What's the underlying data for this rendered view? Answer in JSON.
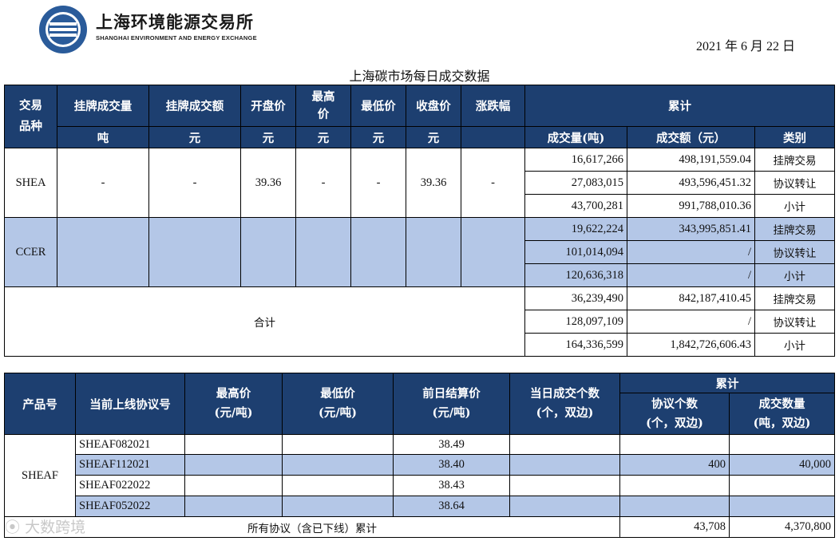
{
  "header": {
    "brand_cn": "上海环境能源交易所",
    "brand_en": "SHANGHAI ENVIRONMENT AND ENERGY EXCHANGE",
    "date": "2021 年 6 月 22 日",
    "title": "上海碳市场每日成交数据"
  },
  "t1": {
    "h": {
      "product": "交易\n品种",
      "listed_vol": "挂牌成交量",
      "listed_amt": "挂牌成交额",
      "open": "开盘价",
      "high": "最高\n价",
      "low": "最低价",
      "close": "收盘价",
      "change": "涨跌幅",
      "cumulative": "累计",
      "u_ton": "吨",
      "u_yuan1": "元",
      "u_yuan2": "元",
      "u_yuan3": "元",
      "u_yuan4": "元",
      "u_yuan5": "元",
      "vol": "成交量(吨)",
      "amt": "成交额（元）",
      "cat": "类别"
    },
    "shea": {
      "name": "SHEA",
      "listed_vol": "-",
      "listed_amt": "-",
      "open": "39.36",
      "high": "-",
      "low": "-",
      "close": "39.36",
      "change": "-",
      "rows": [
        {
          "vol": "16,617,266",
          "amt": "498,191,559.04",
          "cat": "挂牌交易"
        },
        {
          "vol": "27,083,015",
          "amt": "493,596,451.32",
          "cat": "协议转让"
        },
        {
          "vol": "43,700,281",
          "amt": "991,788,010.36",
          "cat": "小计"
        }
      ]
    },
    "ccer": {
      "name": "CCER",
      "rows": [
        {
          "vol": "19,622,224",
          "amt": "343,995,851.41",
          "cat": "挂牌交易"
        },
        {
          "vol": "101,014,094",
          "amt": "/",
          "cat": "协议转让"
        },
        {
          "vol": "120,636,318",
          "amt": "/",
          "cat": "小计"
        }
      ]
    },
    "total": {
      "name": "合计",
      "rows": [
        {
          "vol": "36,239,490",
          "amt": "842,187,410.45",
          "cat": "挂牌交易"
        },
        {
          "vol": "128,097,109",
          "amt": "/",
          "cat": "协议转让"
        },
        {
          "vol": "164,336,599",
          "amt": "1,842,726,606.43",
          "cat": "小计"
        }
      ]
    }
  },
  "t2": {
    "h": {
      "product": "产品号",
      "contract": "当前上线协议号",
      "high": "最高价",
      "high_u": "(元/吨)",
      "low": "最低价",
      "low_u": "(元/吨)",
      "settle": "前日结算价",
      "settle_u": "(元/吨)",
      "deals": "当日成交个数",
      "deals_u": "(个，双边)",
      "cumulative": "累计",
      "agreements": "协议个数",
      "agreements_u": "(个，双边)",
      "qty": "成交数量",
      "qty_u": "(吨，双边)"
    },
    "product": "SHEAF",
    "rows": [
      {
        "contract": "SHEAF082021",
        "high": "",
        "low": "",
        "settle": "38.49",
        "deals": "",
        "agreements": "",
        "qty": ""
      },
      {
        "contract": "SHEAF112021",
        "high": "",
        "low": "",
        "settle": "38.40",
        "deals": "",
        "agreements": "400",
        "qty": "40,000"
      },
      {
        "contract": "SHEAF022022",
        "high": "",
        "low": "",
        "settle": "38.43",
        "deals": "",
        "agreements": "",
        "qty": ""
      },
      {
        "contract": "SHEAF052022",
        "high": "",
        "low": "",
        "settle": "38.64",
        "deals": "",
        "agreements": "",
        "qty": ""
      }
    ],
    "total": {
      "label": "所有协议（含已下线）累计",
      "agreements": "43,708",
      "qty": "4,370,800"
    }
  },
  "watermark": "大数跨境",
  "colors": {
    "header_bg": "#1d3f70",
    "row_blue": "#b4c7e7"
  }
}
